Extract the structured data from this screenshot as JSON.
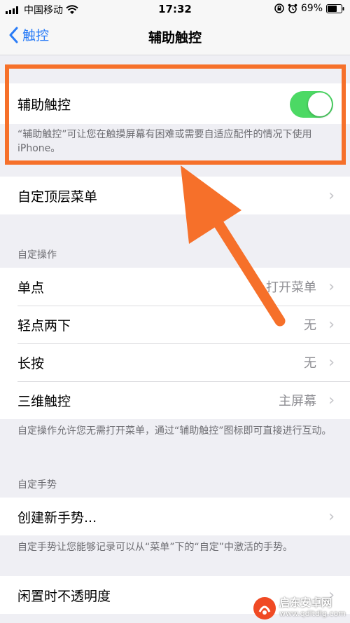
{
  "status_bar": {
    "carrier": "中国移动",
    "time": "17:32",
    "battery": "69%"
  },
  "nav": {
    "back_label": "触控",
    "title": "辅助触控"
  },
  "assistive_touch": {
    "label": "辅助触控",
    "enabled": true,
    "description": "“辅助触控”可让您在触摸屏幕有困难或需要自适应配件的情况下使用 iPhone。"
  },
  "customize_menu": {
    "label": "自定顶层菜单"
  },
  "custom_actions": {
    "header": "自定操作",
    "items": [
      {
        "label": "单点",
        "value": "打开菜单"
      },
      {
        "label": "轻点两下",
        "value": "无"
      },
      {
        "label": "长按",
        "value": "无"
      },
      {
        "label": "三维触控",
        "value": "主屏幕"
      }
    ],
    "footer": "自定操作允许您无需打开菜单，通过“辅助触控”图标即可直接进行互动。"
  },
  "custom_gestures": {
    "header": "自定手势",
    "create_label": "创建新手势...",
    "footer": "自定手势让您能够记录可以从“菜单”下的“自定”中激活的手势。"
  },
  "idle_opacity": {
    "label": "闲置时不透明度"
  },
  "watermark": {
    "title": "启东安卓网",
    "url": "www.qdltdlg.com"
  },
  "colors": {
    "accent": "#2a7cf7",
    "toggle_on": "#4cd964",
    "annotation": "#f6702a"
  }
}
